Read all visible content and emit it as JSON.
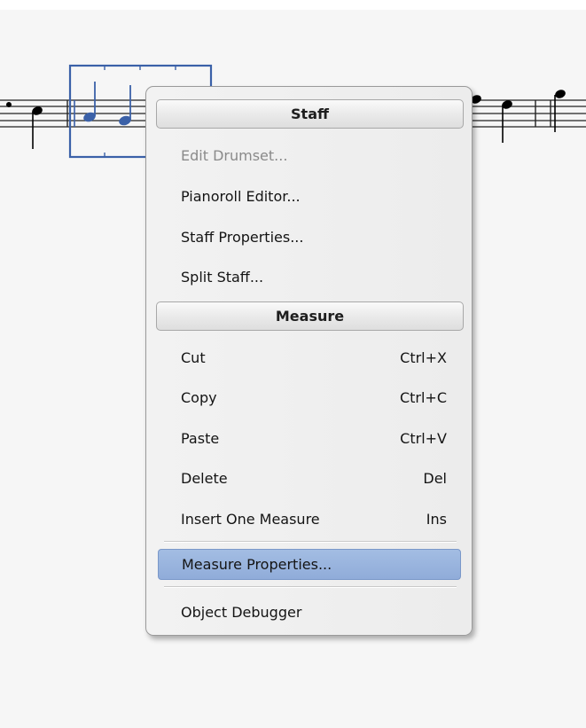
{
  "score": {
    "notes": [
      "quarter-note-black",
      "quarter-note-selected",
      "quarter-note-selected",
      "quarter-note-black",
      "quarter-note-black",
      "quarter-note-black"
    ]
  },
  "menu": {
    "staff_header": "Staff",
    "staff_items": [
      {
        "label": "Edit Drumset...",
        "disabled": true
      },
      {
        "label": "Pianoroll Editor..."
      },
      {
        "label": "Staff Properties..."
      },
      {
        "label": "Split Staff..."
      }
    ],
    "measure_header": "Measure",
    "measure_items": [
      {
        "label": "Cut",
        "shortcut": "Ctrl+X"
      },
      {
        "label": "Copy",
        "shortcut": "Ctrl+C"
      },
      {
        "label": "Paste",
        "shortcut": "Ctrl+V"
      },
      {
        "label": "Delete",
        "shortcut": "Del"
      },
      {
        "label": "Insert One Measure",
        "shortcut": "Ins"
      }
    ],
    "measure_properties": "Measure Properties...",
    "object_debugger": "Object Debugger"
  },
  "colors": {
    "selection": "#3b61a8",
    "highlight": "#98b4df",
    "note": "#000000"
  }
}
